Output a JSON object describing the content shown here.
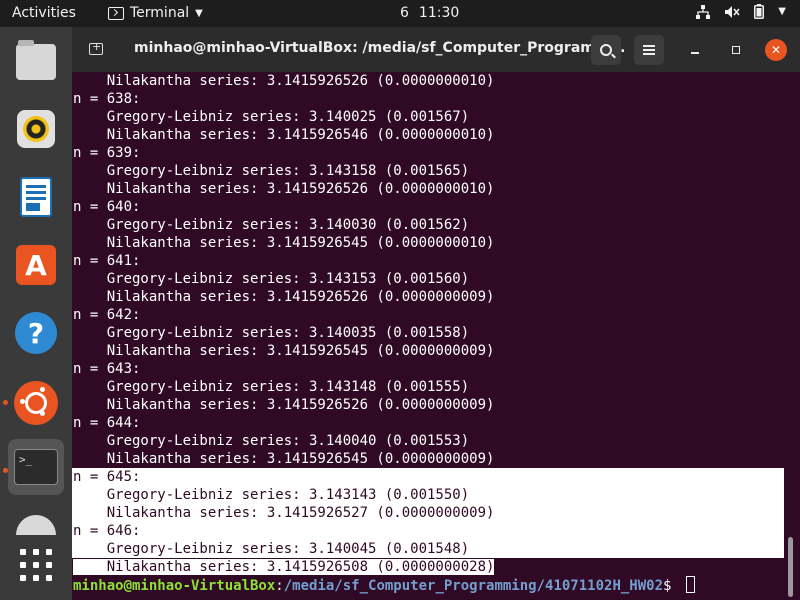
{
  "topbar": {
    "activities": "Activities",
    "app_name": "Terminal",
    "clock_day": "6",
    "clock_time": "11:30"
  },
  "dock": {
    "items": [
      "Files",
      "Rhythmbox",
      "LibreOffice Writer",
      "Ubuntu Software",
      "Help",
      "Ubuntu",
      "Terminal",
      "Show Applications"
    ],
    "terminal_glyph": ">_"
  },
  "window": {
    "title": "minhao@minhao-VirtualBox: /media/sf_Computer_Programm...",
    "close_label": "✕"
  },
  "terminal": {
    "lines": [
      "    Nilakantha series: 3.1415926526 (0.0000000010)",
      "n = 638:",
      "    Gregory-Leibniz series: 3.140025 (0.001567)",
      "    Nilakantha series: 3.1415926546 (0.0000000010)",
      "n = 639:",
      "    Gregory-Leibniz series: 3.143158 (0.001565)",
      "    Nilakantha series: 3.1415926526 (0.0000000010)",
      "n = 640:",
      "    Gregory-Leibniz series: 3.140030 (0.001562)",
      "    Nilakantha series: 3.1415926545 (0.0000000010)",
      "n = 641:",
      "    Gregory-Leibniz series: 3.143153 (0.001560)",
      "    Nilakantha series: 3.1415926526 (0.0000000009)",
      "n = 642:",
      "    Gregory-Leibniz series: 3.140035 (0.001558)",
      "    Nilakantha series: 3.1415926545 (0.0000000009)",
      "n = 643:",
      "    Gregory-Leibniz series: 3.143148 (0.001555)",
      "    Nilakantha series: 3.1415926526 (0.0000000009)",
      "n = 644:",
      "    Gregory-Leibniz series: 3.140040 (0.001553)",
      "    Nilakantha series: 3.1415926545 (0.0000000009)"
    ],
    "selected_lines": [
      "n = 645:",
      "    Gregory-Leibniz series: 3.143143 (0.001550)",
      "    Nilakantha series: 3.1415926527 (0.0000000009)",
      "n = 646:",
      "    Gregory-Leibniz series: 3.140045 (0.001548)"
    ],
    "last_selected_line": "    Nilakantha series: 3.1415926508 (0.0000000028)",
    "prompt_user": "minhao@minhao-VirtualBox",
    "prompt_sep": ":",
    "prompt_path": "/media/sf_Computer_Programming/41071102H_HW02",
    "prompt_symbol": "$ "
  }
}
